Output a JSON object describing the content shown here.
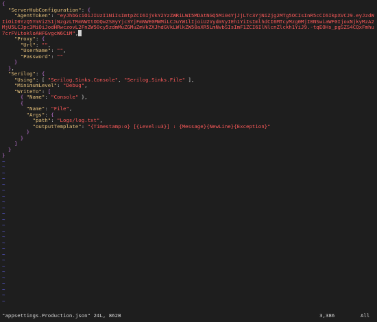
{
  "colors": {
    "background": "#1e1e1e",
    "brace": "#c678dd",
    "key": "#e5c07b",
    "string": "#ff5a5a",
    "punctuation": "#d4d4d4",
    "tilde": "#5b5bd6",
    "placeholder": "#ff5a5a",
    "cursor": "#d4d4d4"
  },
  "editor": {
    "lines": [
      {
        "indent": "",
        "tokens": [
          {
            "t": "{",
            "c": "brace"
          }
        ]
      },
      {
        "indent": "  ",
        "tokens": [
          {
            "t": "\"ServerHubConfiguration\"",
            "c": "key"
          },
          {
            "t": ": ",
            "c": "punctuation"
          },
          {
            "t": "{",
            "c": "brace"
          }
        ]
      },
      {
        "indent": "    ",
        "wrap": true,
        "tokens": [
          {
            "t": "\"AgentToken\"",
            "c": "key"
          },
          {
            "t": ": ",
            "c": "punctuation"
          },
          {
            "t": "\"eyJhbGciOiJIUzI1NiIsImtpZCI6IjVkY2YzZWRiLWI5MDAtNGQ5Mi04YjJjLTc3YjNiZjg2MTg5OCIsInR5cCI6IkpXVCJ9.eyJzdWIiOiI0YzQ5YmViZS1jNzgzLTRmNWItODQwZS0yYjc3YjFmNWE0MWMiLCJuYW1lIjoiU2VydmVyIEh1YiIsImlhdCI6MTcyMzg0MjI0NSwiaWF0IjoxNjkyMzA2MjU5LCJpc3MiOiJodHRwczovL2FnZW50cy5zdmMuZGMuZmVkZXJhdGVkLWlkZW50aXR5LmNvbSIsImF1ZCI6IlNlcnZlckh1YiJ9.-tqEOHs_pgSZS4CQxFmhu7crFVLtokloAHFGvgcW6CiM\"",
            "c": "string"
          },
          {
            "t": ",",
            "c": "punctuation"
          }
        ]
      },
      {
        "indent": "    ",
        "tokens": [
          {
            "t": "\"Proxy\"",
            "c": "key"
          },
          {
            "t": ": ",
            "c": "punctuation"
          },
          {
            "t": "{",
            "c": "brace"
          }
        ]
      },
      {
        "indent": "      ",
        "tokens": [
          {
            "t": "\"Url\"",
            "c": "key"
          },
          {
            "t": ": ",
            "c": "punctuation"
          },
          {
            "t": "\"\"",
            "c": "string"
          },
          {
            "t": ",",
            "c": "punctuation"
          }
        ]
      },
      {
        "indent": "      ",
        "tokens": [
          {
            "t": "\"UserName\"",
            "c": "key"
          },
          {
            "t": ": ",
            "c": "punctuation"
          },
          {
            "t": "\"\"",
            "c": "string"
          },
          {
            "t": ",",
            "c": "punctuation"
          }
        ]
      },
      {
        "indent": "      ",
        "tokens": [
          {
            "t": "\"Password\"",
            "c": "key"
          },
          {
            "t": ": ",
            "c": "punctuation"
          },
          {
            "t": "\"\"",
            "c": "string"
          }
        ]
      },
      {
        "indent": "    ",
        "tokens": [
          {
            "t": "}",
            "c": "brace"
          }
        ]
      },
      {
        "indent": "  ",
        "tokens": [
          {
            "t": "}",
            "c": "brace"
          },
          {
            "t": ",",
            "c": "punctuation"
          }
        ]
      },
      {
        "indent": "  ",
        "tokens": [
          {
            "t": "\"Serilog\"",
            "c": "key"
          },
          {
            "t": ": ",
            "c": "punctuation"
          },
          {
            "t": "{",
            "c": "brace"
          }
        ]
      },
      {
        "indent": "    ",
        "tokens": [
          {
            "t": "\"Using\"",
            "c": "key"
          },
          {
            "t": ": [ ",
            "c": "punctuation"
          },
          {
            "t": "\"Serilog.Sinks.Console\"",
            "c": "string"
          },
          {
            "t": ", ",
            "c": "punctuation"
          },
          {
            "t": "\"Serilog.Sinks.File\"",
            "c": "string"
          },
          {
            "t": " ],",
            "c": "punctuation"
          }
        ]
      },
      {
        "indent": "    ",
        "tokens": [
          {
            "t": "\"MinimumLevel\"",
            "c": "key"
          },
          {
            "t": ": ",
            "c": "punctuation"
          },
          {
            "t": "\"Debug\"",
            "c": "string"
          },
          {
            "t": ",",
            "c": "punctuation"
          }
        ]
      },
      {
        "indent": "    ",
        "tokens": [
          {
            "t": "\"WriteTo\"",
            "c": "key"
          },
          {
            "t": ": ",
            "c": "punctuation"
          },
          {
            "t": "[",
            "c": "brace"
          }
        ]
      },
      {
        "indent": "      ",
        "tokens": [
          {
            "t": "{ ",
            "c": "brace"
          },
          {
            "t": "\"Name\"",
            "c": "key"
          },
          {
            "t": ": ",
            "c": "punctuation"
          },
          {
            "t": "\"Console\"",
            "c": "string"
          },
          {
            "t": " },",
            "c": "punctuation"
          }
        ]
      },
      {
        "indent": "      ",
        "tokens": [
          {
            "t": "{",
            "c": "brace"
          }
        ]
      },
      {
        "indent": "        ",
        "tokens": [
          {
            "t": "\"Name\"",
            "c": "key"
          },
          {
            "t": ": ",
            "c": "punctuation"
          },
          {
            "t": "\"File\"",
            "c": "string"
          },
          {
            "t": ",",
            "c": "punctuation"
          }
        ]
      },
      {
        "indent": "        ",
        "tokens": [
          {
            "t": "\"Args\"",
            "c": "key"
          },
          {
            "t": ": ",
            "c": "punctuation"
          },
          {
            "t": "{",
            "c": "brace"
          }
        ]
      },
      {
        "indent": "          ",
        "tokens": [
          {
            "t": "\"path\"",
            "c": "key"
          },
          {
            "t": ": ",
            "c": "punctuation"
          },
          {
            "t": "\"Logs/log.txt\"",
            "c": "string"
          },
          {
            "t": ",",
            "c": "punctuation"
          }
        ]
      },
      {
        "indent": "          ",
        "tokens": [
          {
            "t": "\"outputTemplate\"",
            "c": "key"
          },
          {
            "t": ": ",
            "c": "punctuation"
          },
          {
            "t": "\"{Timestamp:o} [{Level:u3}] : {Message}{NewLine}{Exception}\"",
            "c": "string"
          }
        ]
      },
      {
        "indent": "        ",
        "tokens": [
          {
            "t": "}",
            "c": "brace"
          }
        ]
      },
      {
        "indent": "      ",
        "tokens": [
          {
            "t": "}",
            "c": "brace"
          }
        ]
      },
      {
        "indent": "    ",
        "tokens": [
          {
            "t": "]",
            "c": "brace"
          }
        ]
      },
      {
        "indent": "  ",
        "tokens": [
          {
            "t": "}",
            "c": "brace"
          }
        ]
      },
      {
        "indent": "",
        "tokens": [
          {
            "t": "}",
            "c": "brace"
          }
        ]
      }
    ],
    "empty_marker": "~",
    "empty_line_count": 25
  },
  "statusbar": {
    "file_info": "\"appsettings.Production.json\" 24L, 862B",
    "cursor_position": "3,386",
    "scroll_position": "All"
  }
}
